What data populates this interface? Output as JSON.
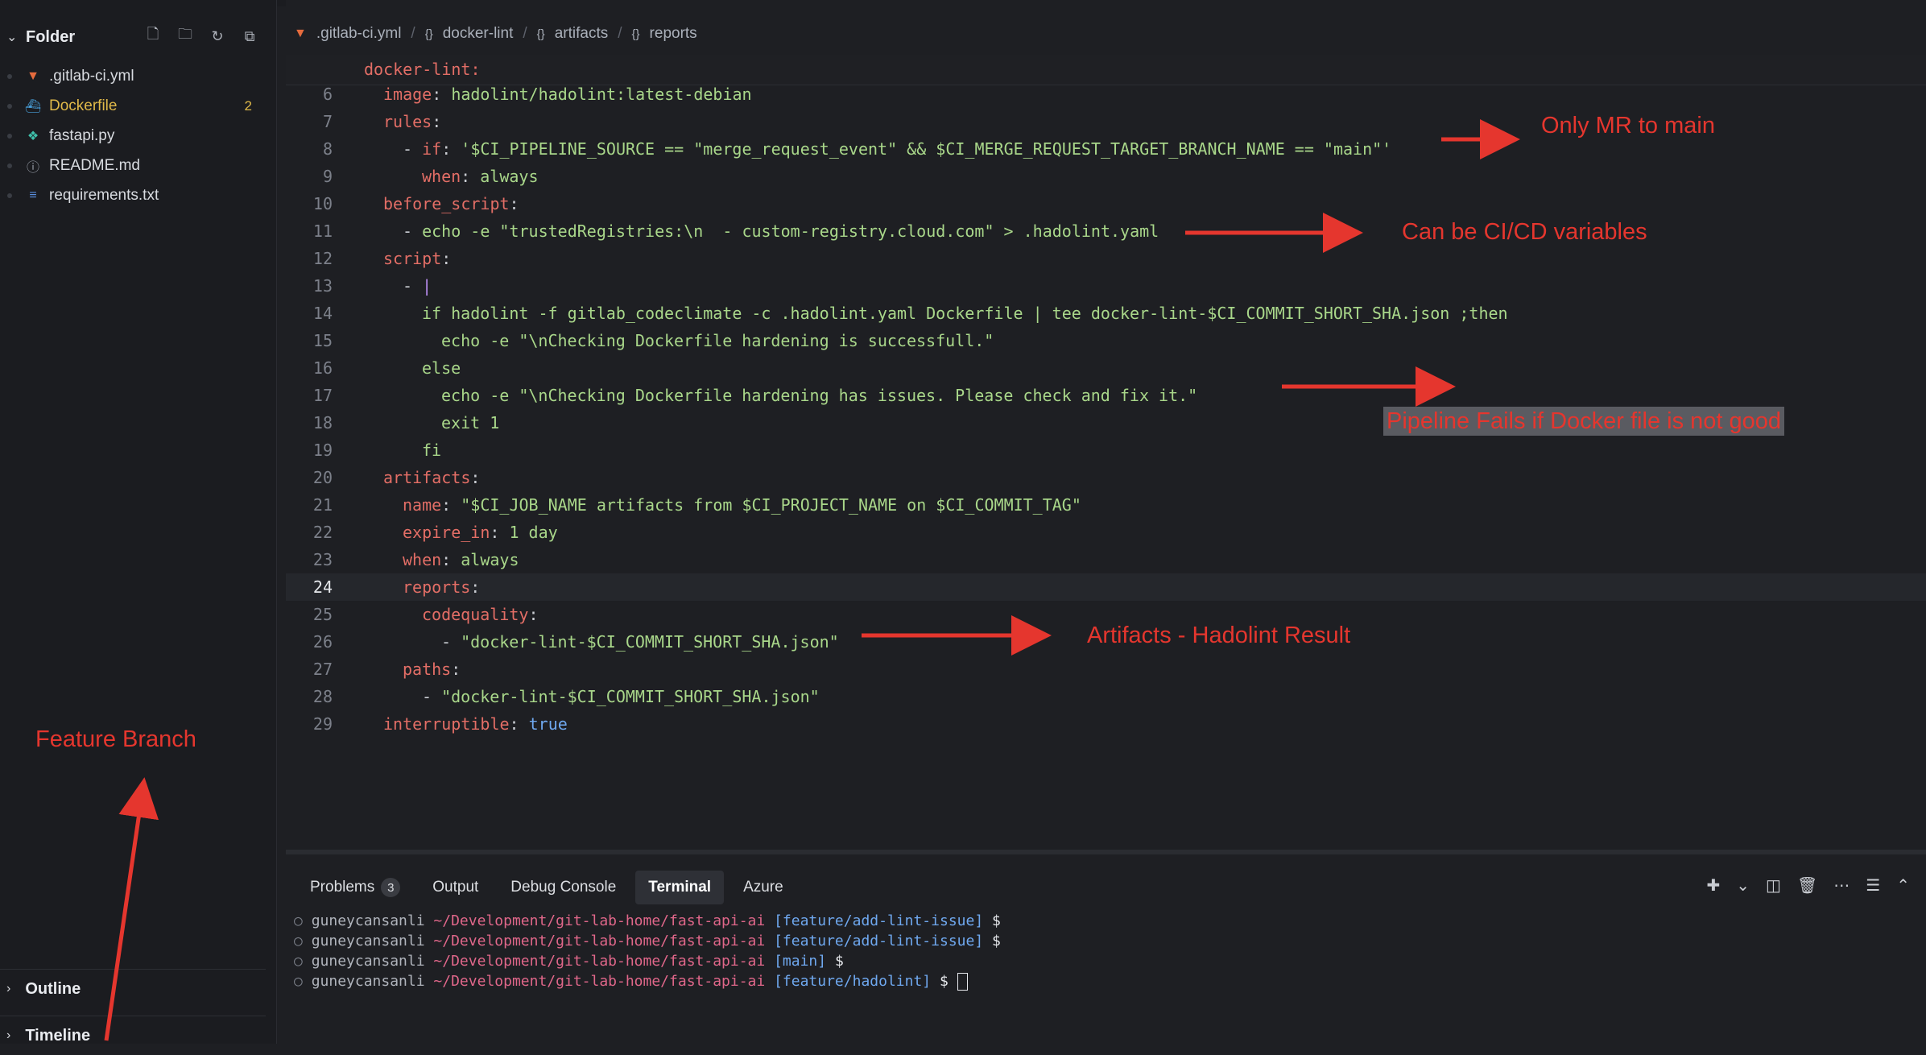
{
  "sidebar": {
    "title": "Folder",
    "files": [
      {
        "name": ".gitlab-ci.yml",
        "icon": "gitlab-icon",
        "color": "#d8dbe0"
      },
      {
        "name": "Dockerfile",
        "icon": "docker-icon",
        "color": "#e0b949",
        "badge": "2"
      },
      {
        "name": "fastapi.py",
        "icon": "python-icon",
        "color": "#d8dbe0"
      },
      {
        "name": "README.md",
        "icon": "info-icon",
        "color": "#d8dbe0"
      },
      {
        "name": "requirements.txt",
        "icon": "lines-icon",
        "color": "#d8dbe0"
      }
    ],
    "outline": "Outline",
    "timeline": "Timeline"
  },
  "breadcrumb": {
    "file": ".gitlab-ci.yml",
    "items": [
      "docker-lint",
      "artifacts",
      "reports"
    ],
    "separator": "/"
  },
  "editor": {
    "sticky_scroll": "docker-lint:",
    "current_line": 24,
    "lines": [
      {
        "num": "6"
      },
      {
        "num": "7"
      },
      {
        "num": "8"
      },
      {
        "num": "9"
      },
      {
        "num": "10"
      },
      {
        "num": "11"
      },
      {
        "num": "12"
      },
      {
        "num": "13"
      },
      {
        "num": "14"
      },
      {
        "num": "15"
      },
      {
        "num": "16"
      },
      {
        "num": "17"
      },
      {
        "num": "18"
      },
      {
        "num": "19"
      },
      {
        "num": "20"
      },
      {
        "num": "21"
      },
      {
        "num": "22"
      },
      {
        "num": "23"
      },
      {
        "num": "24"
      },
      {
        "num": "25"
      },
      {
        "num": "26"
      },
      {
        "num": "27"
      },
      {
        "num": "28"
      },
      {
        "num": "29"
      }
    ],
    "code": {
      "l6k": "image",
      "l6v": "hadolint/hadolint:latest-debian",
      "l7k": "rules",
      "l8k": "if",
      "l8v": "'$CI_PIPELINE_SOURCE == \"merge_request_event\" && $CI_MERGE_REQUEST_TARGET_BRANCH_NAME == \"main\"'",
      "l9k": "when",
      "l9v": "always",
      "l10k": "before_script",
      "l11v": "echo -e \"trustedRegistries:\\n  - custom-registry.cloud.com\" > .hadolint.yaml",
      "l12k": "script",
      "l13v": "|",
      "l14v": "if hadolint -f gitlab_codeclimate -c .hadolint.yaml Dockerfile | tee docker-lint-$CI_COMMIT_SHORT_SHA.json ;then",
      "l15v": "echo -e \"\\nChecking Dockerfile hardening is successfull.\"",
      "l16v": "else",
      "l17v": "echo -e \"\\nChecking Dockerfile hardening has issues. Please check and fix it.\"",
      "l18v": "exit 1",
      "l19v": "fi",
      "l20k": "artifacts",
      "l21k": "name",
      "l21v": "\"$CI_JOB_NAME artifacts from $CI_PROJECT_NAME on $CI_COMMIT_TAG\"",
      "l22k": "expire_in",
      "l22v": "1 day",
      "l23k": "when",
      "l23v": "always",
      "l24k": "reports",
      "l25k": "codequality",
      "l26v": "\"docker-lint-$CI_COMMIT_SHORT_SHA.json\"",
      "l27k": "paths",
      "l28v": "\"docker-lint-$CI_COMMIT_SHORT_SHA.json\"",
      "l29k": "interruptible",
      "l29v": "true"
    }
  },
  "annotations": {
    "mr_main": "Only MR to main",
    "cicd_vars": "Can be CI/CD variables",
    "pipeline_fails": "Pipeline Fails if Docker file is not good",
    "artifacts": "Artifacts - Hadolint Result",
    "feature_branch": "Feature Branch"
  },
  "panel": {
    "tabs": [
      {
        "label": "Problems",
        "count": "3"
      },
      {
        "label": "Output"
      },
      {
        "label": "Debug Console"
      },
      {
        "label": "Terminal",
        "active": true
      },
      {
        "label": "Azure"
      }
    ],
    "terminal": [
      {
        "user": "guneycansanli",
        "path": "~/Development/git-lab-home/fast-api-ai",
        "branch": "[feature/add-lint-issue]",
        "prompt": "$"
      },
      {
        "user": "guneycansanli",
        "path": "~/Development/git-lab-home/fast-api-ai",
        "branch": "[feature/add-lint-issue]",
        "prompt": "$"
      },
      {
        "user": "guneycansanli",
        "path": "~/Development/git-lab-home/fast-api-ai",
        "branch": "[main]",
        "prompt": "$"
      },
      {
        "user": "guneycansanli",
        "path": "~/Development/git-lab-home/fast-api-ai",
        "branch": "[feature/hadolint]",
        "prompt": "$"
      }
    ]
  },
  "colors": {
    "annotation": "#e5362e",
    "key": "#e36e66",
    "string": "#a9d78a",
    "boolean": "#6fa8ef"
  }
}
